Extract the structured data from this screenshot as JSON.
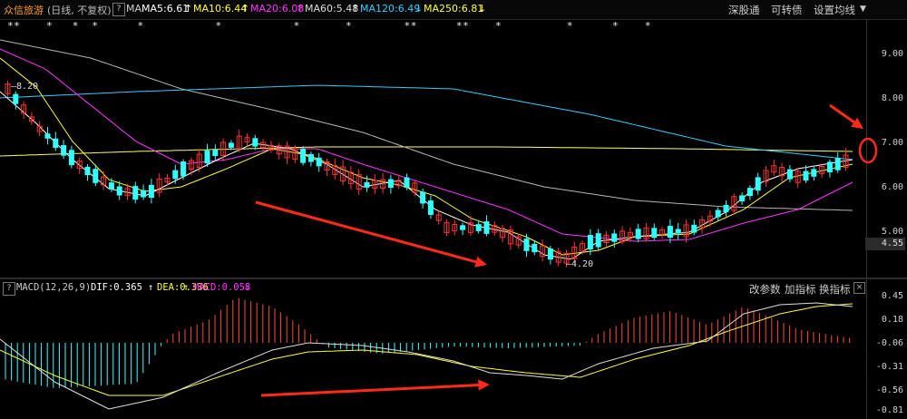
{
  "header": {
    "stock_name": "众信旅游",
    "period": "(日线, 不复权)",
    "help": "?",
    "ma_label": "MA",
    "ma5": "MA5:6.61",
    "ma10": "MA10:6.44",
    "ma20": "MA20:6.08",
    "ma60": "MA60:5.48",
    "ma120": "MA120:6.49",
    "ma250": "MA250:6.81",
    "up_arrow": "↑",
    "down_arrow": "↓",
    "btn_shengutong": "深股通",
    "btn_kezhuanzhai": "可转债",
    "btn_settings": "设置均线"
  },
  "colors": {
    "ma5": "#ffffff",
    "ma10": "#ffff33",
    "ma20": "#ff33ff",
    "ma60": "#33ff33",
    "ma120": "#33ccff",
    "ma250": "#ffff33",
    "up": "#ff3333",
    "down": "#33ffff",
    "annotation": "#ff2a1a"
  },
  "price_axis": {
    "ticks": [
      "9.00",
      "8.00",
      "7.00",
      "6.00",
      "5.00"
    ],
    "last_price": "4.55"
  },
  "price_annotations": {
    "high": "8.20",
    "low": "4.20"
  },
  "star_markers": "**    *   *  *      *           *           *       *        **      **    *          *      *    *",
  "macd": {
    "title": "MACD(12,26,9)",
    "help": "?",
    "dif": "DIF:0.365",
    "dea": "DEA:0.336",
    "macd": "MACD:0.058",
    "up_arrow": "↑",
    "down_arrow": "↓",
    "btn_params": "改参数",
    "btn_add": "加指标",
    "btn_switch": "换指标",
    "close": "×",
    "axis_ticks": [
      "0.45",
      "0.18",
      "-0.06",
      "-0.31",
      "-0.56",
      "-0.81"
    ]
  }
}
